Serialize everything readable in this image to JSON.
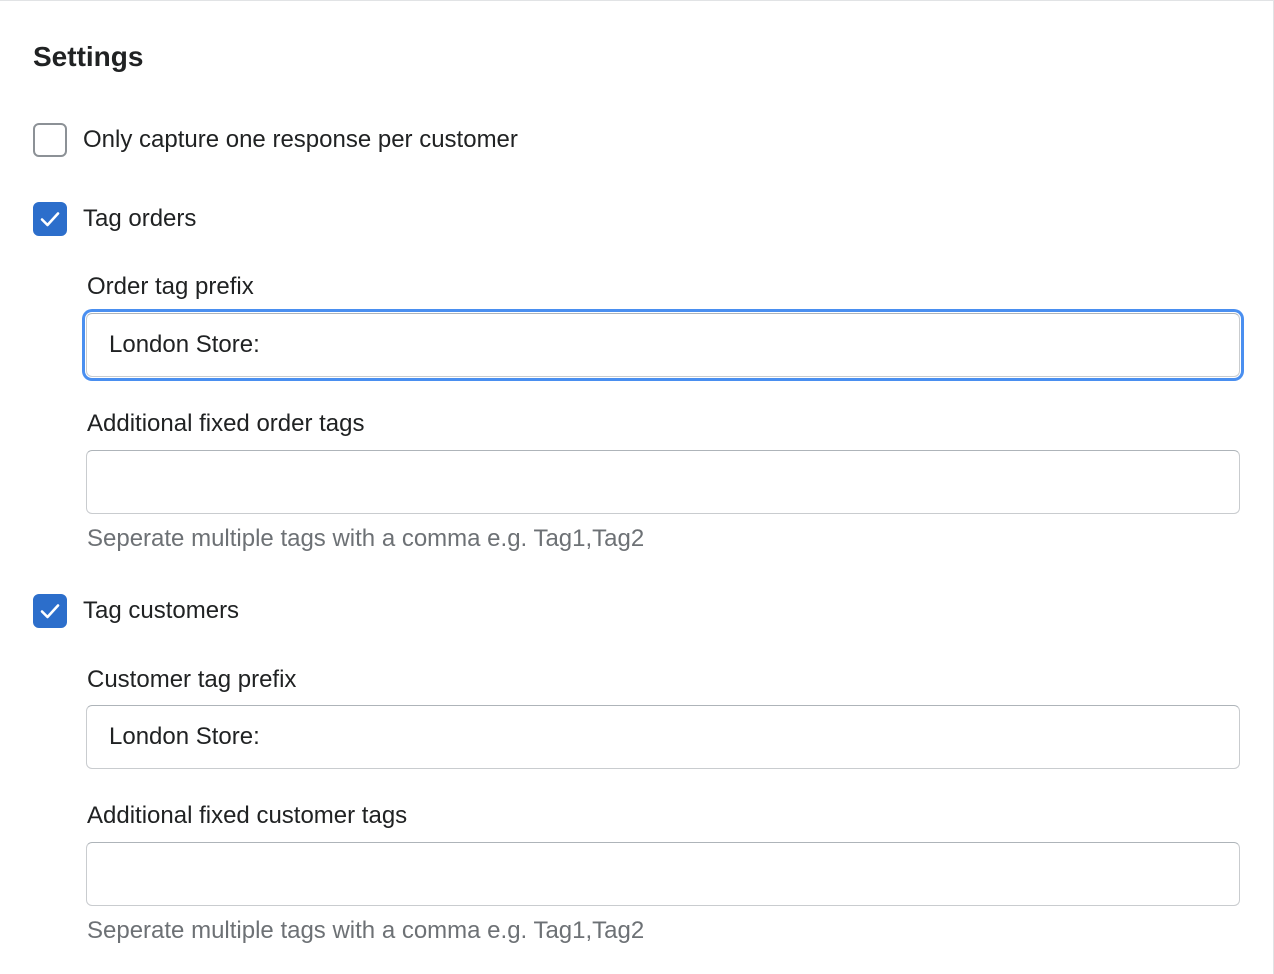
{
  "section": {
    "title": "Settings"
  },
  "options": {
    "one_response": {
      "label": "Only capture one response per customer",
      "checked": false
    },
    "tag_orders": {
      "label": "Tag orders",
      "checked": true
    },
    "tag_customers": {
      "label": "Tag customers",
      "checked": true
    }
  },
  "order_fields": {
    "prefix_label": "Order tag prefix",
    "prefix_value": "London Store:",
    "fixed_tags_label": "Additional fixed order tags",
    "fixed_tags_value": "",
    "help_text": "Seperate multiple tags with a comma e.g. Tag1,Tag2"
  },
  "customer_fields": {
    "prefix_label": "Customer tag prefix",
    "prefix_value": "London Store:",
    "fixed_tags_label": "Additional fixed customer tags",
    "fixed_tags_value": "",
    "help_text": "Seperate multiple tags with a comma e.g. Tag1,Tag2"
  },
  "icons": {
    "checkmark": "checkmark-icon"
  },
  "colors": {
    "accent": "#2c6ecb",
    "focus_ring": "#4a8ff0",
    "help_text": "#6d7175",
    "border": "#c9cccf"
  }
}
